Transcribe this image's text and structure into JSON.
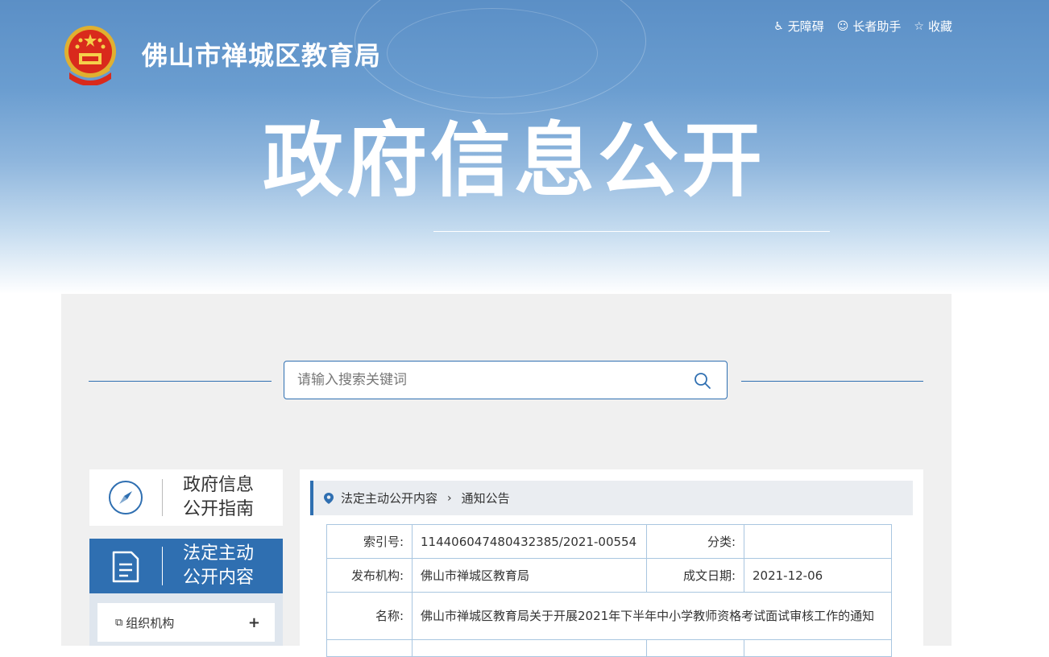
{
  "header": {
    "site_name": "佛山市禅城区教育局",
    "banner_title": "政府信息公开",
    "links": [
      {
        "icon": "accessibility-icon",
        "label": "无障碍"
      },
      {
        "icon": "elder-helper-icon",
        "label": "长者助手"
      },
      {
        "icon": "star-icon",
        "label": "收藏"
      }
    ]
  },
  "search": {
    "placeholder": "请输入搜索关键词",
    "value": ""
  },
  "sidebar": {
    "guide_label": "政府信息公开指南",
    "guide_line1": "政府信息",
    "guide_line2": "公开指南",
    "active_line1": "法定主动",
    "active_line2": "公开内容",
    "items": [
      {
        "label": "组织机构",
        "toggle": "+"
      }
    ]
  },
  "breadcrumb": {
    "parent": "法定主动公开内容",
    "current": "通知公告"
  },
  "info": {
    "index_label": "索引号:",
    "index_value": "114406047480432385/2021-00554",
    "category_label": "分类:",
    "category_value": "",
    "publisher_label": "发布机构:",
    "publisher_value": "佛山市禅城区教育局",
    "date_label": "成文日期:",
    "date_value": "2021-12-06",
    "name_label": "名称:",
    "name_value": "佛山市禅城区教育局关于开展2021年下半年中小学教师资格考试面试审核工作的通知"
  },
  "colors": {
    "accent": "#2f6fb1",
    "panel_bg": "#f0f0f0",
    "crumb_bg": "#eaedf1",
    "table_border": "#a9c6e0"
  }
}
